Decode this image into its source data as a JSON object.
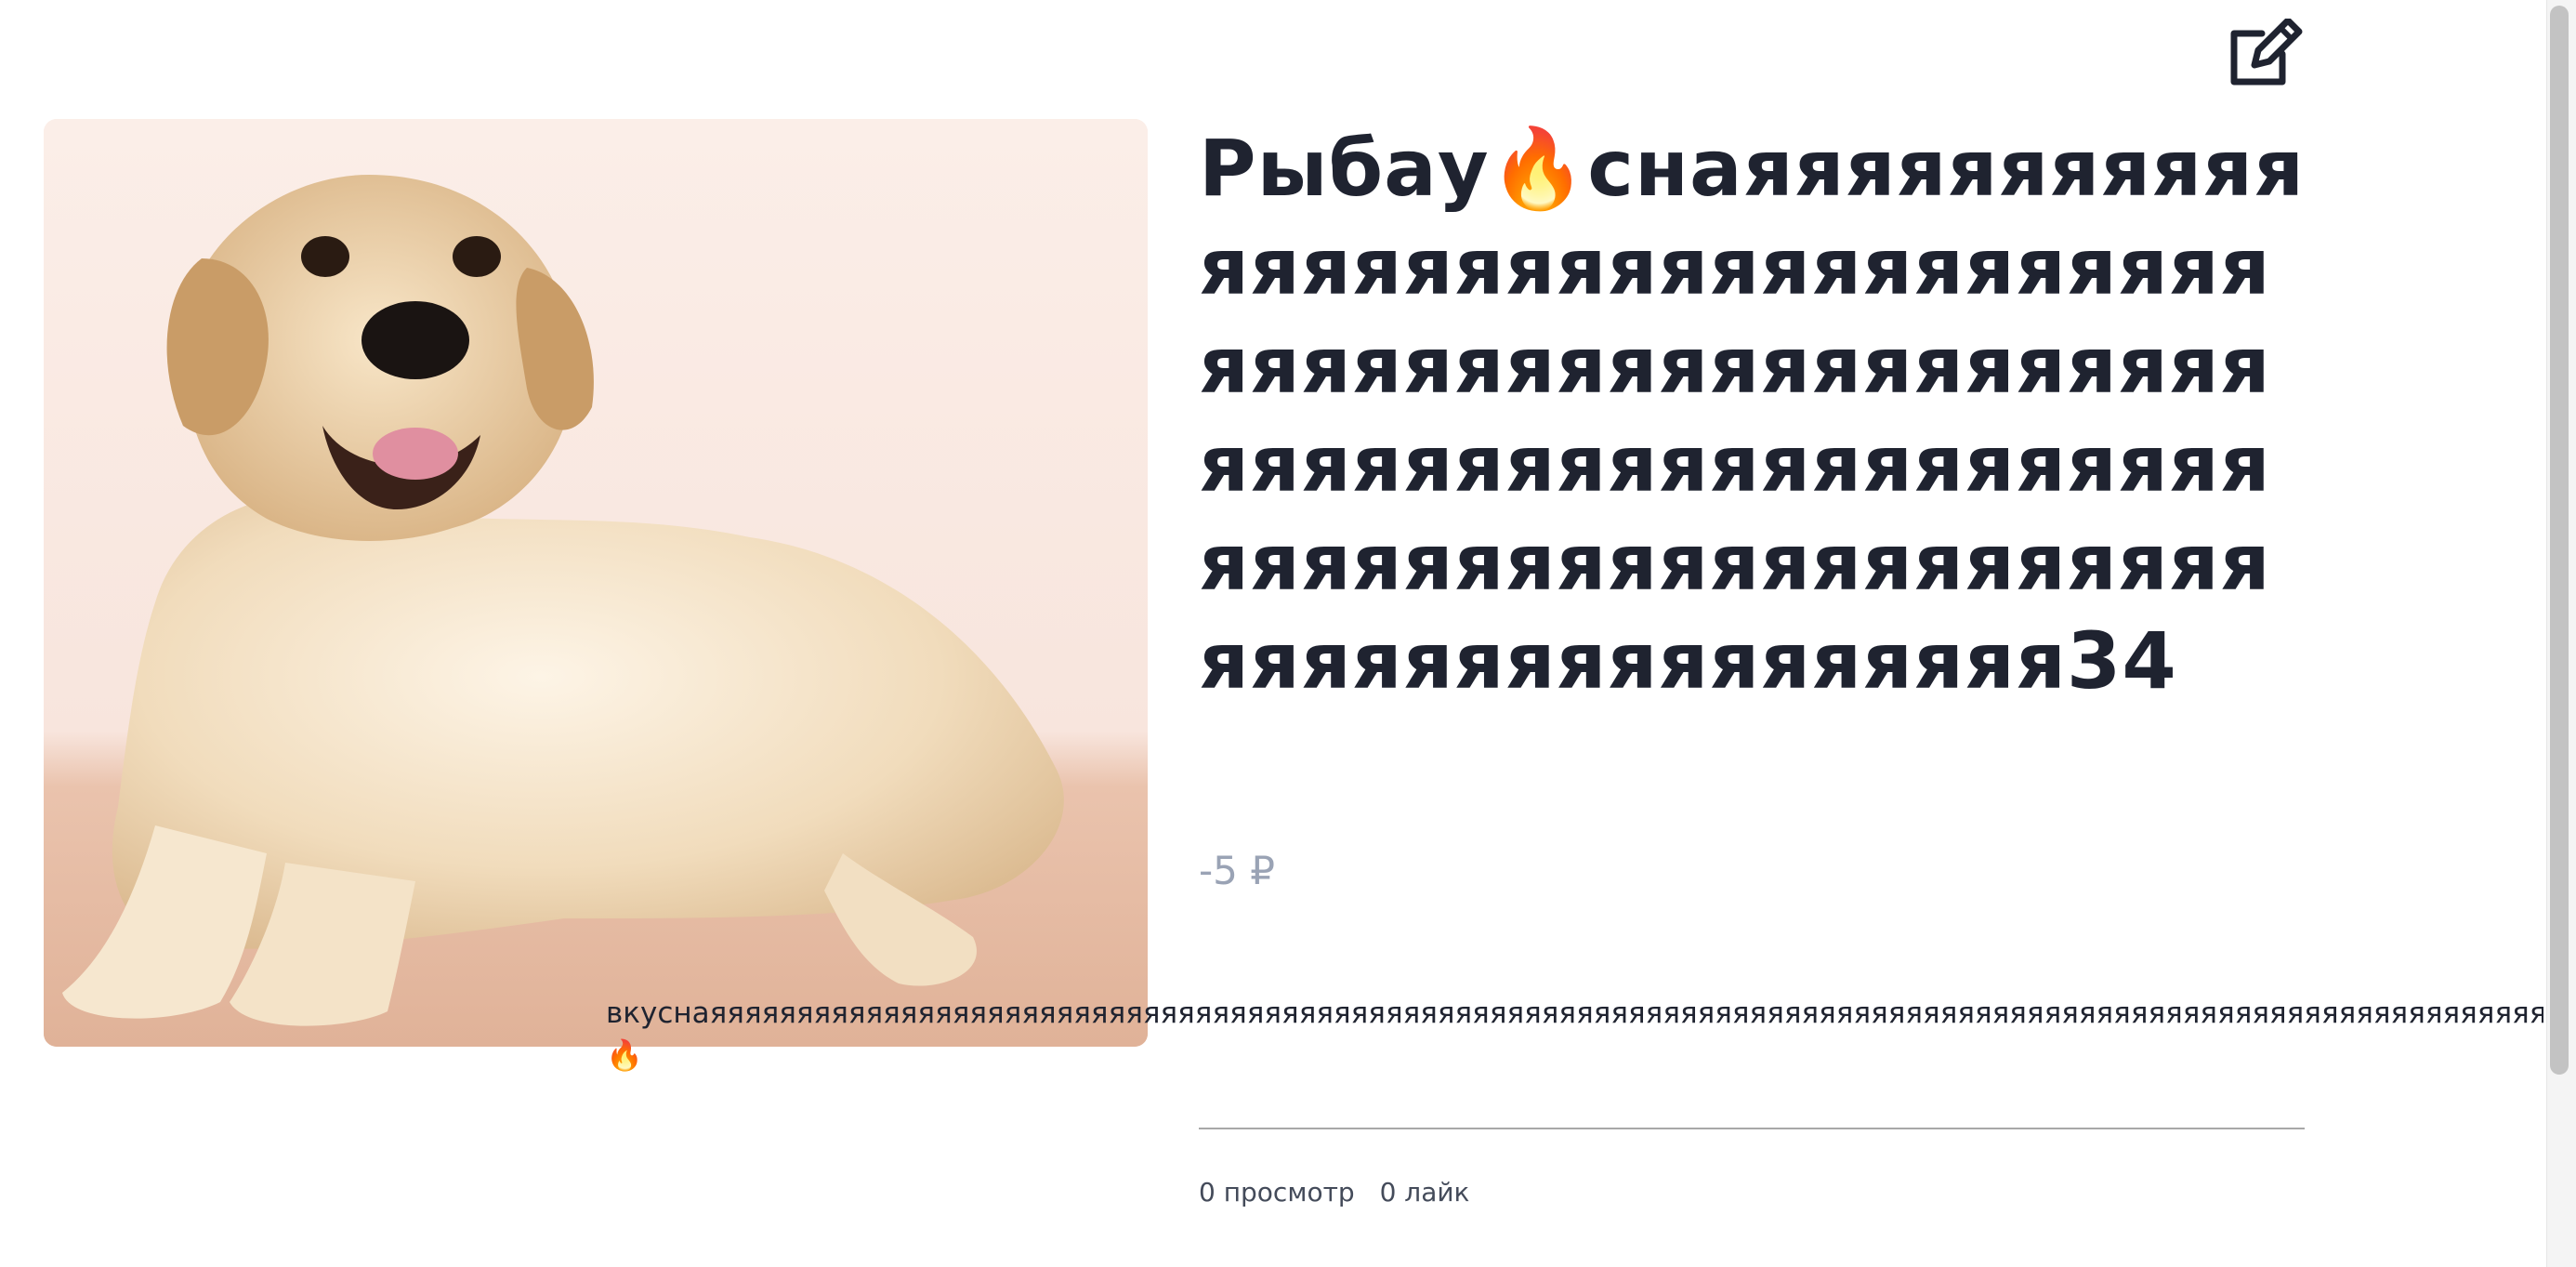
{
  "product": {
    "title": "Рыбау🔥снаяяяяяяяяяяяяяяяяяяяяяяяяяяяяяяяяяяяяяяяяяяяяяяяяяяяяяяяяяяяяяяяяяяяяяяяяяяяяяяяяяяяяяяяяяяяяяяяяяяяяяяяяяяяяяяяя34",
    "price": "-5 ₽",
    "description": "вкуснаяяяяяяяяяяяяяяяяяяяяяяяяяяяяяяяяяяяяяяяяяяяяяяяяяяяяяяяяяяяяяяяяяяяяяяяяяяяяяяяяяяяяяяяяяяяяяяяяяяяяяяяяяяяяяяяяяяяяяяяяяяяяяяяяяяяяяяяяяяяяяяяяяяяяяяяяяяяяяяяяяяя",
    "description_emoji": "🔥",
    "image_icon": "dog-photo",
    "views": "0 просмотр",
    "likes": "0 лайк"
  },
  "toolbar": {
    "edit_icon": "edit-icon"
  },
  "colors": {
    "text": "#1f2330",
    "price": "#9aa3b5",
    "divider": "#a8a8a8"
  }
}
